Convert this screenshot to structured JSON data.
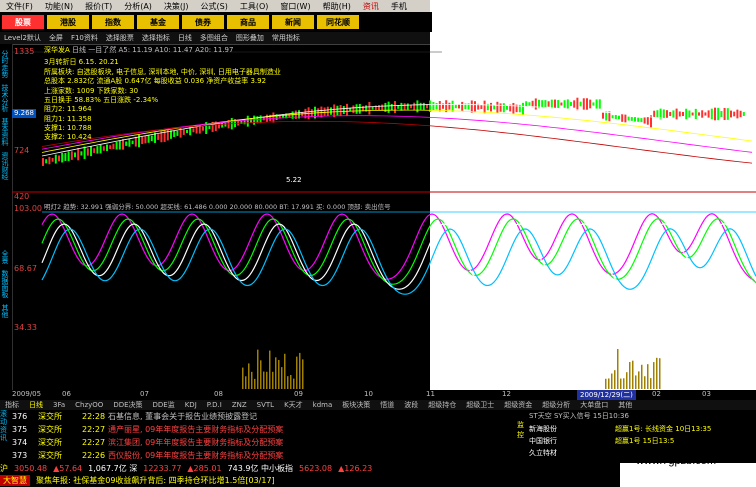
{
  "menu": [
    "文件(F)",
    "功能(N)",
    "报价(T)",
    "分析(A)",
    "决策(J)",
    "公式(S)",
    "工具(O)",
    "窗口(W)",
    "帮助(H)",
    "资讯",
    "手机"
  ],
  "menu_hot_index": 9,
  "buttons": [
    "股票",
    "港股",
    "指数",
    "基金",
    "债券",
    "商品",
    "新闻",
    "同花顺"
  ],
  "toolbar2": [
    "Level2默认",
    "全屏",
    "F10资料",
    "选择股票",
    "选择指标",
    "日线",
    "多图组合",
    "图形叠加",
    "常用指标"
  ],
  "sidebar_top": [
    "分时走势",
    "技术分析",
    "基本资料",
    "资讯财经"
  ],
  "sidebar_bottom": [
    "全景",
    "数据面板",
    "其他"
  ],
  "stock": {
    "title": "深华发A",
    "line1": "日线 一目了然 A5: 11.19 A10: 11.47 A20: 11.97",
    "date": "3月转折日 6.15. 20.21",
    "industry": "所属板块: 自选股板块, 电子信息, 深圳本地, 中价, 深圳, 日用电子器具制造业",
    "capital": "总股本 2.832亿 流通A股 0.647亿 每股收益 0.036 净资产收益率 3.92",
    "counts": "上涨家数: 1009    下跌家数: 30",
    "turnover": "五日换手 58.83%  五日涨跌 -2.34%",
    "levels": [
      "阻力2: 11.964",
      "阻力1: 11.358",
      "支撑1: 10.788",
      "支撑2: 10.424"
    ],
    "low_label": "5.22",
    "price_tag": "9.268"
  },
  "y_axis_top": [
    "1335",
    "724",
    "420"
  ],
  "y_axis_bottom": [
    "103.00",
    "68.67",
    "34.33"
  ],
  "indicator_line": "明灯2 趋势: 32.991  强弱分界: 50.000  超买线: 61.486  0.000  20.000  80.000  BT: 17.991  买: 0.000  顶部: 卖出信号",
  "dates": [
    "2009/05",
    "06",
    "07",
    "08",
    "09",
    "10",
    "11",
    "12",
    "2009/12/29(二)",
    "02",
    "03"
  ],
  "tabs": [
    "指标",
    "日线",
    "3Fa",
    "ChzyOO",
    "DDE决策",
    "DDE监",
    "KDJ",
    "P.D.I",
    "ZNZ",
    "SVTL",
    "K天才",
    "kdma",
    "板块决策",
    "悟道",
    "波段",
    "超级持仓",
    "超级卫士",
    "超级资金",
    "超级分析",
    "大单盘口",
    "其他"
  ],
  "active_tab_index": 1,
  "news": [
    {
      "num": "376",
      "src": "深交所",
      "time": "22:28",
      "title": "石基信息, 董事会关于报告业绩预披露登记"
    },
    {
      "num": "375",
      "src": "深交所",
      "time": "22:27",
      "title": "通产丽星, 09年年度报告主要财务指标及分配预案"
    },
    {
      "num": "374",
      "src": "深交所",
      "time": "22:27",
      "title": "滨江集团, 09年年度报告主要财务指标及分配预案"
    },
    {
      "num": "373",
      "src": "深交所",
      "time": "22:26",
      "title": "西仪股份, 09年年度报告主要财务指标及分配预案"
    }
  ],
  "news_side": [
    "滚动资讯"
  ],
  "right_panel": {
    "label": "监控",
    "header": "ST天空   SY买入信号 15日10:36",
    "items": [
      "新海股份",
      "中国银行",
      "久立特材"
    ],
    "signals": [
      "超赢1号: 长线资金  10日13:35",
      "超赢1号  15日13:5"
    ]
  },
  "quotes": [
    {
      "label": "沪",
      "value": "3050.48",
      "color": "#ff4040"
    },
    {
      "label": "",
      "value": "▲57.64",
      "color": "#ff4040"
    },
    {
      "label": "",
      "value": "1,067.7亿 深",
      "color": "#ffffff"
    },
    {
      "label": "",
      "value": "12233.77",
      "color": "#ff4040"
    },
    {
      "label": "",
      "value": "▲285.01",
      "color": "#ff4040"
    },
    {
      "label": "",
      "value": "743.9亿 中小板指",
      "color": "#ffffff"
    },
    {
      "label": "",
      "value": "5623.08",
      "color": "#ff4040"
    },
    {
      "label": "",
      "value": "▲126.23",
      "color": "#ff4040"
    }
  ],
  "ticker": {
    "brand": "大智慧",
    "text": "聚焦年报: 社保基金09收益飙升背后: 四季持仓环比增1.5倍[03/17]"
  },
  "watermark": "www.7gpzb.com",
  "colors": {
    "up": "#ff3030",
    "down": "#00ff00",
    "yellow": "#ffff00",
    "blue": "#00c0ff"
  }
}
